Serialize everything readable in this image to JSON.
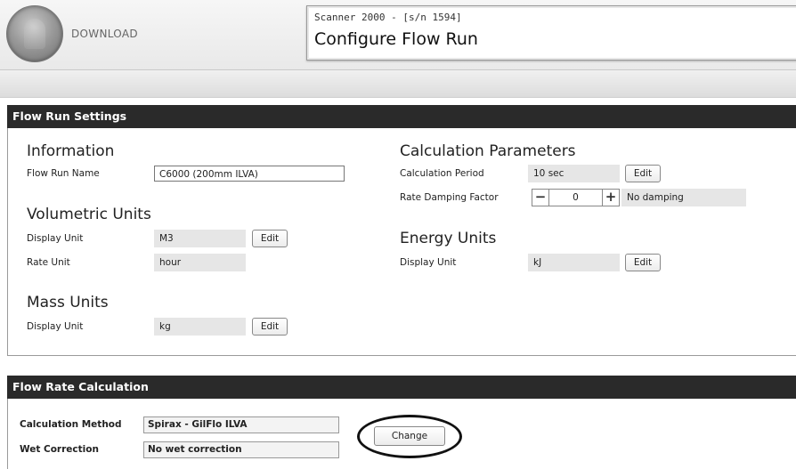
{
  "header": {
    "download_label": "DOWNLOAD",
    "device": "Scanner 2000 -  [s/n 1594]",
    "title": "Configure Flow Run"
  },
  "flow_run_settings": {
    "panel_title": "Flow Run Settings",
    "information": {
      "heading": "Information",
      "flow_run_name_label": "Flow Run Name",
      "flow_run_name_value": "C6000 (200mm ILVA)"
    },
    "volumetric_units": {
      "heading": "Volumetric Units",
      "display_unit_label": "Display Unit",
      "display_unit_value": "M3",
      "display_unit_edit": "Edit",
      "rate_unit_label": "Rate Unit",
      "rate_unit_value": "hour"
    },
    "mass_units": {
      "heading": "Mass Units",
      "display_unit_label": "Display Unit",
      "display_unit_value": "kg",
      "display_unit_edit": "Edit"
    },
    "calculation_parameters": {
      "heading": "Calculation Parameters",
      "period_label": "Calculation Period",
      "period_value": "10 sec",
      "period_edit": "Edit",
      "damping_label": "Rate Damping Factor",
      "damping_minus": "−",
      "damping_value": "0",
      "damping_plus": "+",
      "damping_note": "No damping"
    },
    "energy_units": {
      "heading": "Energy Units",
      "display_unit_label": "Display Unit",
      "display_unit_value": "kJ",
      "display_unit_edit": "Edit"
    }
  },
  "flow_rate_calculation": {
    "panel_title": "Flow Rate Calculation",
    "method_label": "Calculation Method",
    "method_value": "Spirax - GilFlo ILVA",
    "wet_label": "Wet Correction",
    "wet_value": "No wet correction",
    "change_button": "Change"
  }
}
